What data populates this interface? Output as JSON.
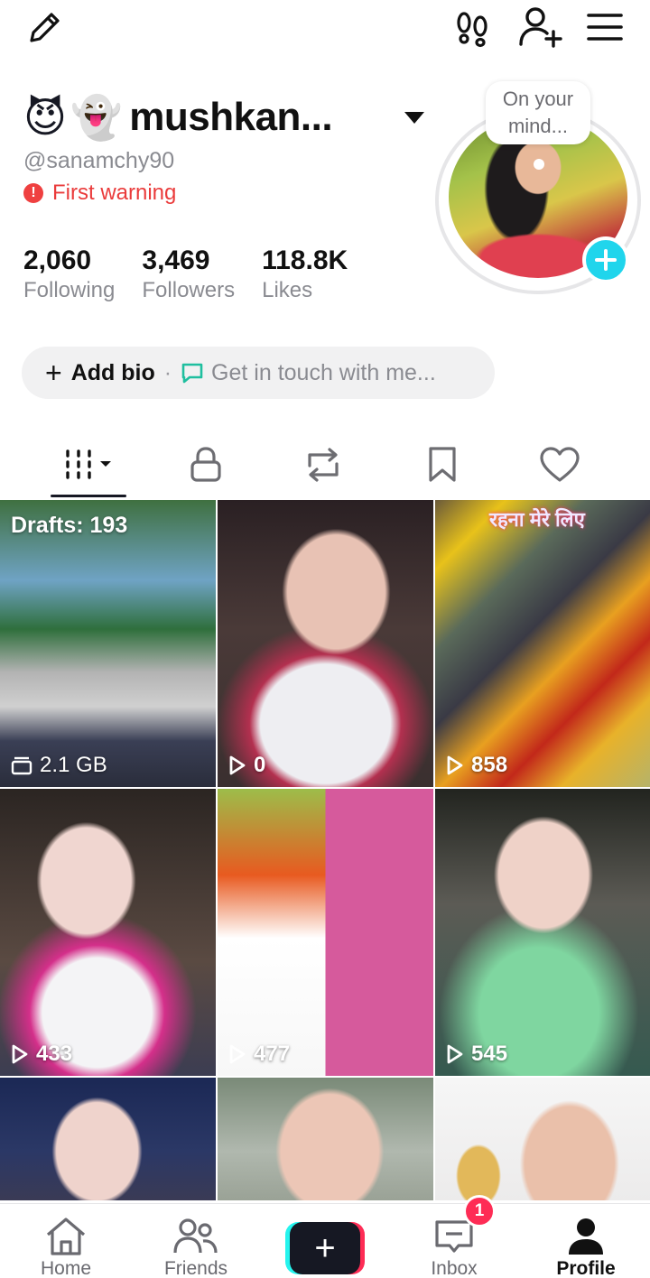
{
  "profile": {
    "emojis": [
      "😈",
      "👻"
    ],
    "display_name": "mushkan...",
    "handle": "@sanamchy90",
    "warning": "First warning",
    "stats": [
      {
        "value": "2,060",
        "label": "Following"
      },
      {
        "value": "3,469",
        "label": "Followers"
      },
      {
        "value": "118.8K",
        "label": "Likes"
      }
    ],
    "avatar_note_line1": "On your",
    "avatar_note_line2": "mind..."
  },
  "bio": {
    "add_label": "Add bio",
    "separator": "·",
    "contact_label": "Get in touch with me..."
  },
  "grid": {
    "drafts_label": "Drafts: 193",
    "drafts_size": "2.1 GB",
    "overlay_text": "रहना मेरे लिए",
    "videos": [
      {
        "views": "0"
      },
      {
        "views": "858"
      },
      {
        "views": "433"
      },
      {
        "views": "477"
      },
      {
        "views": "545"
      }
    ]
  },
  "nav": {
    "home": "Home",
    "friends": "Friends",
    "create": "+",
    "inbox": "Inbox",
    "inbox_badge": "1",
    "profile": "Profile"
  },
  "colors": {
    "accent_cyan": "#20d5ec",
    "warning_red": "#ea3b3b",
    "badge_red": "#fe2c55",
    "text_primary": "#161823",
    "text_secondary": "#8a8b91"
  }
}
